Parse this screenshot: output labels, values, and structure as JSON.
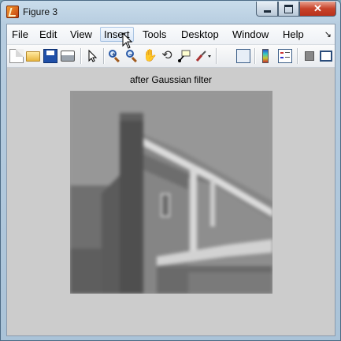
{
  "window": {
    "title": "Figure 3"
  },
  "menu": {
    "items": [
      "File",
      "Edit",
      "View",
      "Insert",
      "Tools",
      "Desktop",
      "Window",
      "Help"
    ]
  },
  "toolbar": {
    "buttons": [
      "new-figure-icon",
      "open-file-icon",
      "save-figure-icon",
      "print-figure-icon",
      "edit-plot-pointer-icon",
      "zoom-in-icon",
      "zoom-out-icon",
      "pan-hand-icon",
      "rotate-3d-icon",
      "data-cursor-icon",
      "brush-icon",
      "link-plot-icon",
      "insert-colorbar-icon",
      "insert-legend-icon",
      "hide-plot-tools-icon",
      "show-plot-tools-icon"
    ]
  },
  "axes": {
    "title": "after Gaussian filter"
  }
}
